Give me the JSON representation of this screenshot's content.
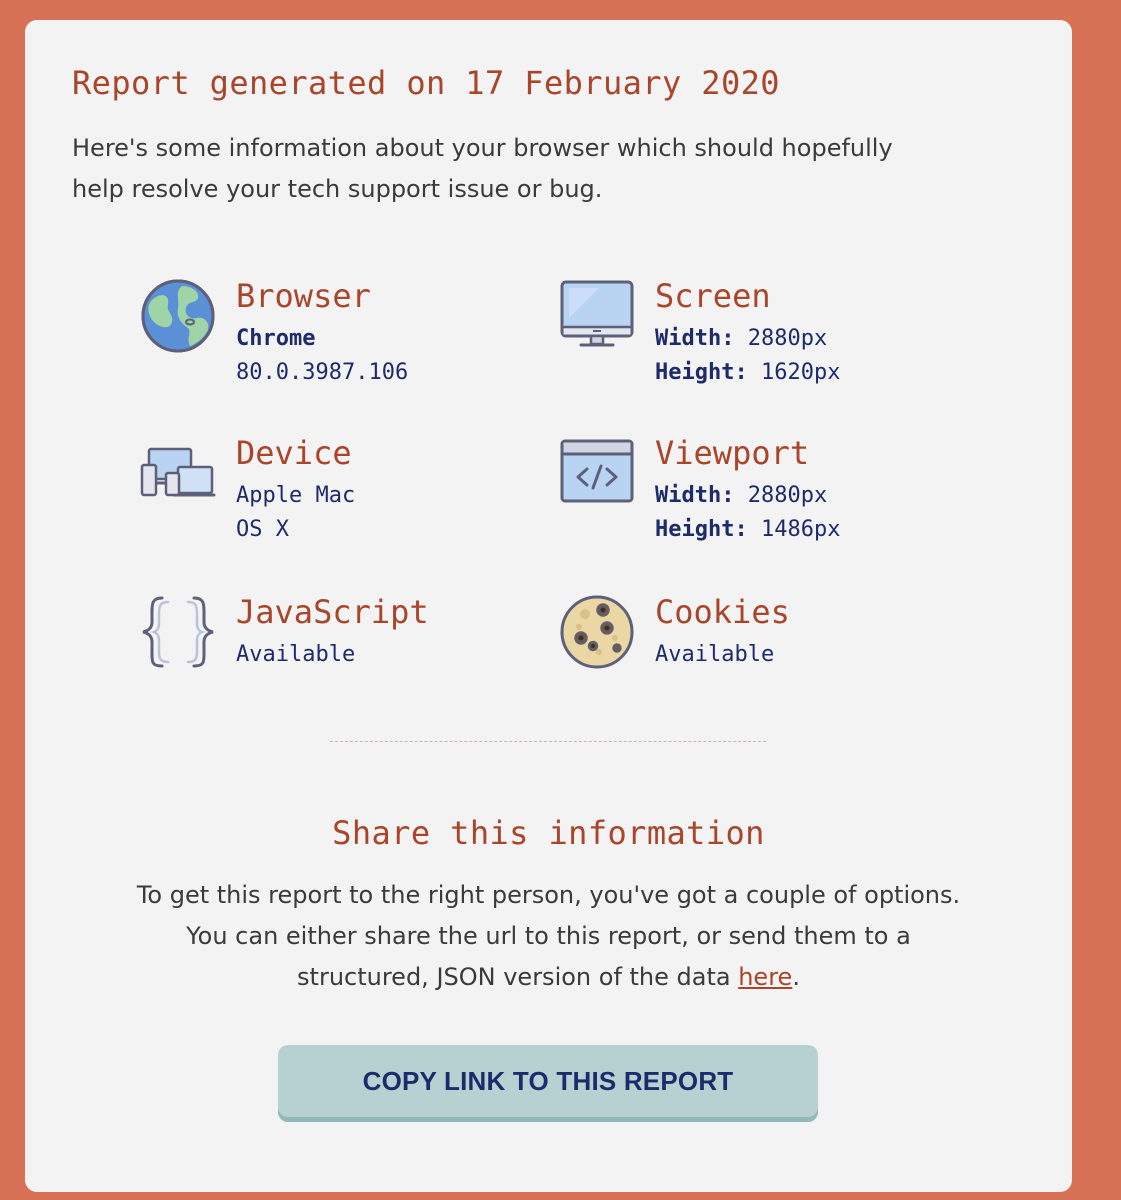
{
  "report": {
    "title": "Report generated on 17 February 2020",
    "intro": "Here's some information about your browser which should hopefully help resolve your tech support issue or bug."
  },
  "items": {
    "browser": {
      "name": "Browser",
      "line1": "Chrome",
      "line2": "80.0.3987.106",
      "icon": "globe-icon"
    },
    "screen": {
      "name": "Screen",
      "width_label": "Width:",
      "width_value": "2880px",
      "height_label": "Height:",
      "height_value": "1620px",
      "icon": "monitor-icon"
    },
    "device": {
      "name": "Device",
      "line1": "Apple Mac",
      "line2": "OS X",
      "icon": "devices-icon"
    },
    "viewport": {
      "name": "Viewport",
      "width_label": "Width:",
      "width_value": "2880px",
      "height_label": "Height:",
      "height_value": "1486px",
      "icon": "code-window-icon"
    },
    "javascript": {
      "name": "JavaScript",
      "line1": "Available",
      "icon": "curly-braces-icon"
    },
    "cookies": {
      "name": "Cookies",
      "line1": "Available",
      "icon": "cookie-icon"
    }
  },
  "share": {
    "title": "Share this information",
    "text_before": "To get this report to the right person, you've got a couple of options. You can either share the url to this report, or send them to a structured, JSON version of the data ",
    "link_label": "here",
    "text_after": ".",
    "button_label": "COPY LINK TO THIS REPORT"
  },
  "colors": {
    "page_background": "#d87257",
    "card_background": "#f3f3f3",
    "heading": "#a8452a",
    "value_text": "#1d2b6b",
    "button": "#b7d1d2"
  }
}
